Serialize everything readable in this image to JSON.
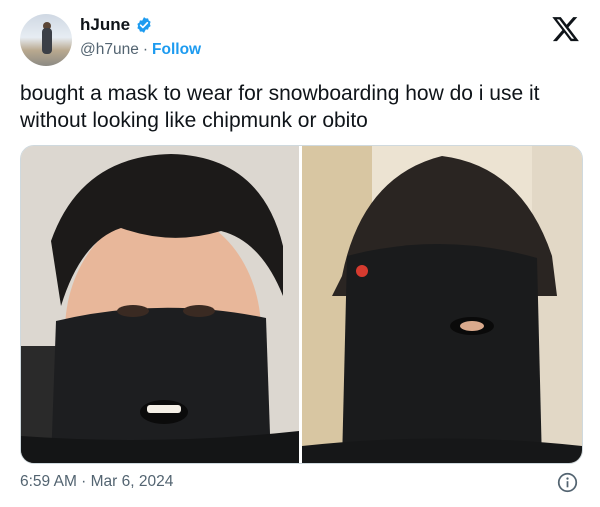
{
  "author": {
    "display_name": "hJune",
    "handle": "@h7une",
    "separator": "·",
    "follow_label": "Follow",
    "verified_icon": "verified-badge-icon"
  },
  "tweet": {
    "text": "bought a mask to wear for snowboarding how do i use it without looking like chipmunk or obito"
  },
  "footer": {
    "timestamp": "6:59 AM · Mar 6, 2024"
  },
  "icons": {
    "brand": "x-logo-icon",
    "info": "info-icon"
  },
  "colors": {
    "link": "#1d9bf0",
    "text": "#0f1419",
    "secondary": "#536471"
  }
}
